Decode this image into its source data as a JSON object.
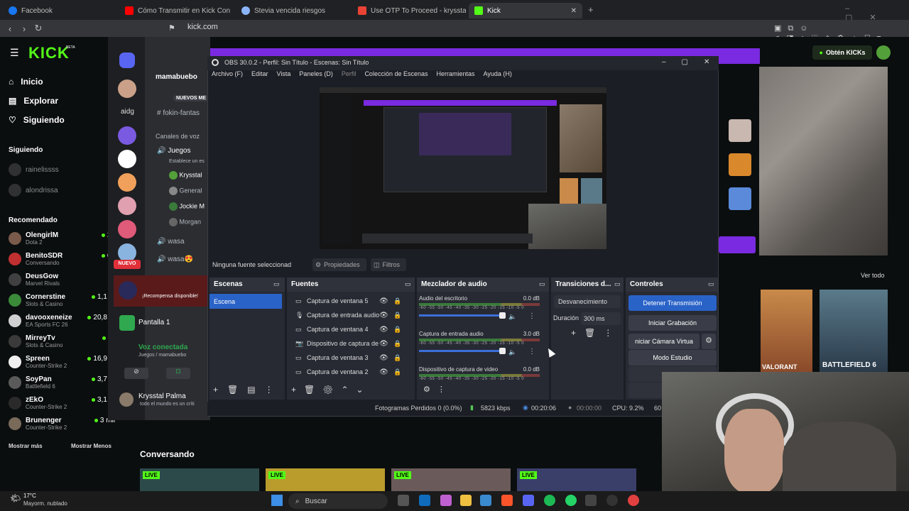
{
  "browser": {
    "tabs": [
      {
        "label": "Facebook",
        "color": "#1877f2"
      },
      {
        "label": "Cómo Transmitir en Kick Con Obs St",
        "color": "#ff0000"
      },
      {
        "label": "Stevia vencida riesgos",
        "color": "#8ab4f8"
      },
      {
        "label": "Use OTP To Proceed - krysstalcrimsc",
        "color": "#ea4335"
      },
      {
        "label": "Kick",
        "color": "#53fc18"
      }
    ],
    "url": "kick.com",
    "profile_name": "mamabuebo"
  },
  "kick": {
    "logo": "KICK",
    "beta": "BETA",
    "nav": [
      "Inicio",
      "Explorar",
      "Siguiendo"
    ],
    "following_header": "Siguiendo",
    "following": [
      "rainelissss",
      "alondrissa"
    ],
    "recommended_header": "Recomendado",
    "recommended": [
      {
        "name": "OlengirlM",
        "game": "Dota 2",
        "viewers": "24"
      },
      {
        "name": "BenitoSDR",
        "game": "Conversando",
        "viewers": "60"
      },
      {
        "name": "DeusGow",
        "game": "Marvel Rivals",
        "viewers": ""
      },
      {
        "name": "Cornerstine",
        "game": "Slots & Casino",
        "viewers": "1,1 m"
      },
      {
        "name": "davooxeneize",
        "game": "EA Sports FC 26",
        "viewers": "20,8 m"
      },
      {
        "name": "MirreyTv",
        "game": "Slots & Casino",
        "viewers": "11"
      },
      {
        "name": "Spreen",
        "game": "Counter-Strike 2",
        "viewers": "16,9 m"
      },
      {
        "name": "SoyPan",
        "game": "Battlefield 6",
        "viewers": "3,7 m"
      },
      {
        "name": "zEkO",
        "game": "Counter-Strike 2",
        "viewers": "3,1 m"
      },
      {
        "name": "Brunenger",
        "game": "Counter-Strike 2",
        "viewers": "3 mil"
      }
    ],
    "show_more": "Mostrar más",
    "show_less": "Mostrar Menos",
    "conversando": "Conversando",
    "live": "LIVE",
    "get_kicks": "Obtén KICKs",
    "ver_todo": "Ver todo",
    "game_cards": [
      "VALORANT",
      "BATTLEFIELD 6"
    ],
    "new_badge": "NUEVO"
  },
  "discord": {
    "server_name": "mamabuebo",
    "new_messages": "NUEVOS ME",
    "channel": "fokin-fantas",
    "voice_header": "Canales de voz",
    "voice_channel": "Juegos",
    "voice_sub": "Establece un es",
    "members": [
      "Krysstal",
      "General",
      "Jockie M",
      "Morgan"
    ],
    "wasa": [
      "wasa",
      "wasa😍"
    ],
    "aidg": "aidg",
    "reward_title": "¡Recompensa disponible!",
    "screen": "Pantalla 1",
    "voice_connected": "Voz conectada",
    "voice_path": "Juegos / mamabuebo",
    "user_name": "Krysstal Palma",
    "user_status": "todo el mundo es un críti"
  },
  "obs": {
    "title": "OBS 30.0.2 - Perfil: Sin Título - Escenas: Sin Título",
    "menu": [
      "Archivo (F)",
      "Editar",
      "Vista",
      "Paneles (D)",
      "Perfil",
      "Colección de Escenas",
      "Herramientas",
      "Ayuda (H)"
    ],
    "no_source": "Ninguna fuente seleccionad",
    "properties": "Propiedades",
    "filters": "Filtros",
    "scenes_title": "Escenas",
    "scene": "Escena",
    "sources_title": "Fuentes",
    "sources": [
      "Captura de ventana 5",
      "Captura de entrada audio",
      "Captura de ventana 4",
      "Dispositivo de captura de v",
      "Captura de ventana 3",
      "Captura de ventana 2"
    ],
    "mixer_title": "Mezclador de audio",
    "mixer": [
      {
        "name": "Audio del escritorio",
        "db": "0.0 dB"
      },
      {
        "name": "Captura de entrada audio",
        "db": "3.0 dB"
      },
      {
        "name": "Dispositivo de captura de video",
        "db": "0.0 dB"
      }
    ],
    "scale": "-60 -55 -50 -45 -40 -35 -30 -25 -20 -15 -10 -5 0",
    "transitions_title": "Transiciones d...",
    "transition": "Desvanecimiento",
    "duration_label": "Duración",
    "duration": "300 ms",
    "controls_title": "Controles",
    "controls": [
      "Detener Transmisión",
      "Iniciar Grabación",
      "niciar Cámara Virtua",
      "Modo Estudio"
    ],
    "status": {
      "dropped": "Fotogramas Perdidos 0 (0.0%)",
      "bitrate": "5823 kbps",
      "live_time": "00:20:06",
      "rec_time": "00:00:00",
      "cpu": "CPU: 9.2%",
      "fps": "60"
    }
  },
  "taskbar": {
    "weather_temp": "17°C",
    "weather_desc": "Mayorm. nublado",
    "search": "Buscar"
  }
}
